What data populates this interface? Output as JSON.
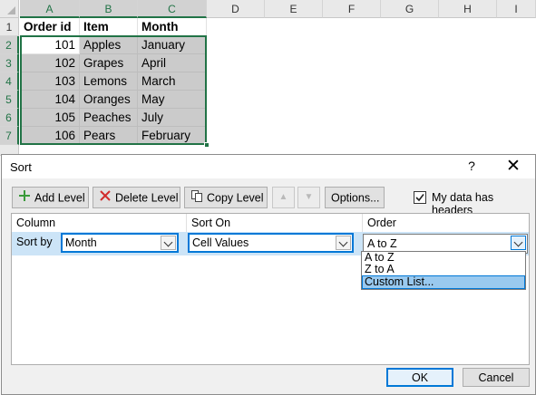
{
  "spreadsheet": {
    "columns": [
      "A",
      "B",
      "C",
      "D",
      "E",
      "F",
      "G",
      "H",
      "I"
    ],
    "rows": [
      "1",
      "2",
      "3",
      "4",
      "5",
      "6",
      "7"
    ],
    "headers": [
      "Order id",
      "Item",
      "Month"
    ],
    "data": [
      [
        "101",
        "Apples",
        "January"
      ],
      [
        "102",
        "Grapes",
        "April"
      ],
      [
        "103",
        "Lemons",
        "March"
      ],
      [
        "104",
        "Oranges",
        "May"
      ],
      [
        "105",
        "Peaches",
        "July"
      ],
      [
        "106",
        "Pears",
        "February"
      ]
    ],
    "selection_color": "#217346"
  },
  "dialog": {
    "title": "Sort",
    "help": "?",
    "close": "✕",
    "toolbar": {
      "add_level": "Add Level",
      "delete_level": "Delete Level",
      "copy_level": "Copy Level",
      "move_up": "▲",
      "move_down": "▼",
      "options": "Options...",
      "headers_checkbox_label": "My data has headers",
      "headers_checked": true,
      "headers_check": "✓"
    },
    "grid": {
      "column_header": "Column",
      "sort_on_header": "Sort On",
      "order_header": "Order",
      "sort_by_label": "Sort by",
      "column_value": "Month",
      "sort_on_value": "Cell Values",
      "order_value": "A to Z"
    },
    "order_options": [
      "A to Z",
      "Z to A",
      "Custom List..."
    ],
    "order_highlighted": "Custom List...",
    "ok": "OK",
    "cancel": "Cancel",
    "accent": "#0078d7"
  }
}
